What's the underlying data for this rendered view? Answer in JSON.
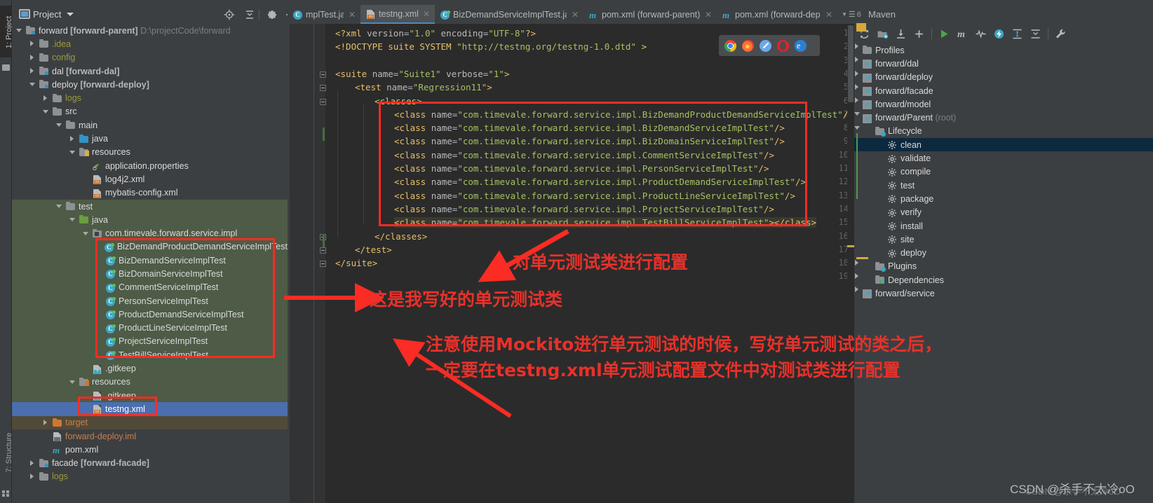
{
  "window": {
    "left_tool_labels": [
      "1: Project",
      "7: Structure"
    ]
  },
  "project_panel": {
    "title": "Project",
    "icons": [
      "locate-icon",
      "collapse-all-icon",
      "gear-icon",
      "minimize-icon"
    ],
    "tree": [
      {
        "indent": 0,
        "twisty": "open",
        "icon": "module-folder-icon",
        "label": "forward ",
        "bold": "[forward-parent]",
        "suffix": "  D:\\projectCode\\forward",
        "style": "white"
      },
      {
        "indent": 1,
        "twisty": "closed",
        "icon": "folder-icon",
        "label": ".idea",
        "style": "folder-yellow"
      },
      {
        "indent": 1,
        "twisty": "closed",
        "icon": "folder-icon",
        "label": "config",
        "style": "folder-yellow"
      },
      {
        "indent": 1,
        "twisty": "closed",
        "icon": "module-folder-icon",
        "label": "dal ",
        "bold": "[forward-dal]",
        "style": "white"
      },
      {
        "indent": 1,
        "twisty": "open",
        "icon": "module-folder-icon",
        "label": "deploy ",
        "bold": "[forward-deploy]",
        "style": "white"
      },
      {
        "indent": 2,
        "twisty": "closed",
        "icon": "folder-icon",
        "label": "logs",
        "style": "folder-yellow"
      },
      {
        "indent": 2,
        "twisty": "open",
        "icon": "folder-icon",
        "label": "src",
        "style": "white"
      },
      {
        "indent": 3,
        "twisty": "open",
        "icon": "folder-icon",
        "label": "main",
        "style": "white"
      },
      {
        "indent": 4,
        "twisty": "closed",
        "icon": "source-folder-blue-icon",
        "label": "java",
        "style": "white"
      },
      {
        "indent": 4,
        "twisty": "open",
        "icon": "resources-folder-icon",
        "label": "resources",
        "style": "white"
      },
      {
        "indent": 5,
        "twisty": "none",
        "icon": "properties-file-icon",
        "label": "application.properties",
        "style": "white"
      },
      {
        "indent": 5,
        "twisty": "none",
        "icon": "xml-file-icon",
        "label": "log4j2.xml",
        "style": "white"
      },
      {
        "indent": 5,
        "twisty": "none",
        "icon": "xml-file-icon",
        "label": "mybatis-config.xml",
        "style": "white"
      },
      {
        "indent": 3,
        "twisty": "open",
        "icon": "folder-icon",
        "label": "test",
        "style": "white",
        "bg": "green"
      },
      {
        "indent": 4,
        "twisty": "open",
        "icon": "test-source-folder-green-icon",
        "label": "java",
        "style": "white",
        "bg": "green"
      },
      {
        "indent": 5,
        "twisty": "open",
        "icon": "package-icon",
        "label": "com.timevale.forward.service.impl",
        "style": "white",
        "bg": "green"
      },
      {
        "indent": 6,
        "twisty": "none",
        "icon": "java-test-class-icon",
        "label": "BizDemandProductDemandServiceImplTest",
        "style": "white",
        "bg": "green"
      },
      {
        "indent": 6,
        "twisty": "none",
        "icon": "java-test-class-icon",
        "label": "BizDemandServiceImplTest",
        "style": "white",
        "bg": "green"
      },
      {
        "indent": 6,
        "twisty": "none",
        "icon": "java-test-class-icon",
        "label": "BizDomainServiceImplTest",
        "style": "white",
        "bg": "green"
      },
      {
        "indent": 6,
        "twisty": "none",
        "icon": "java-test-class-icon",
        "label": "CommentServiceImplTest",
        "style": "white",
        "bg": "green"
      },
      {
        "indent": 6,
        "twisty": "none",
        "icon": "java-test-class-icon",
        "label": "PersonServiceImplTest",
        "style": "white",
        "bg": "green"
      },
      {
        "indent": 6,
        "twisty": "none",
        "icon": "java-test-class-icon",
        "label": "ProductDemandServiceImplTest",
        "style": "white",
        "bg": "green"
      },
      {
        "indent": 6,
        "twisty": "none",
        "icon": "java-test-class-icon",
        "label": "ProductLineServiceImplTest",
        "style": "white",
        "bg": "green"
      },
      {
        "indent": 6,
        "twisty": "none",
        "icon": "java-test-class-icon",
        "label": "ProjectServiceImplTest",
        "style": "white",
        "bg": "green"
      },
      {
        "indent": 6,
        "twisty": "none",
        "icon": "java-test-class-icon",
        "label": "TestBillServiceImplTest",
        "style": "white",
        "bg": "green"
      },
      {
        "indent": 5,
        "twisty": "none",
        "icon": "gitkeep-file-icon",
        "label": ".gitkeep",
        "style": "white",
        "bg": "green"
      },
      {
        "indent": 4,
        "twisty": "open",
        "icon": "test-resources-folder-icon",
        "label": "resources",
        "style": "white",
        "bg": "green"
      },
      {
        "indent": 5,
        "twisty": "none",
        "icon": "gitkeep-file-icon",
        "label": ".gitkeep",
        "style": "white",
        "bg": "green"
      },
      {
        "indent": 5,
        "twisty": "none",
        "icon": "xml-file-icon",
        "label": "testng.xml",
        "style": "white",
        "bg": "selected"
      },
      {
        "indent": 2,
        "twisty": "closed",
        "icon": "target-folder-orange-icon",
        "label": "target",
        "style": "orange",
        "bg": "brown"
      },
      {
        "indent": 2,
        "twisty": "none",
        "icon": "iml-file-icon",
        "label": "forward-deploy.iml",
        "style": "orange"
      },
      {
        "indent": 2,
        "twisty": "none",
        "icon": "maven-pom-icon",
        "label": "pom.xml",
        "style": "white"
      },
      {
        "indent": 1,
        "twisty": "closed",
        "icon": "module-folder-icon",
        "label": "facade ",
        "bold": "[forward-facade]",
        "style": "white"
      },
      {
        "indent": 1,
        "twisty": "closed",
        "icon": "folder-icon",
        "label": "logs",
        "style": "folder-yellow"
      }
    ]
  },
  "editor_tabs": {
    "tabs": [
      {
        "label": "mplTest.java",
        "icon": "java-class-icon",
        "active": false,
        "truncated": true
      },
      {
        "label": "testng.xml",
        "icon": "xml-file-icon",
        "active": true
      },
      {
        "label": "BizDemandServiceImplTest.java",
        "icon": "java-test-class-icon",
        "active": false
      },
      {
        "label": "pom.xml (forward-parent)",
        "icon": "maven-pom-icon",
        "active": false
      },
      {
        "label": "pom.xml (forward-deplo",
        "icon": "maven-pom-icon",
        "active": false,
        "truncated": true
      }
    ],
    "overflow_count": "6",
    "maven_tab_title": "Maven"
  },
  "editor": {
    "filename": "testng.xml",
    "line_numbers": [
      "1",
      "2",
      "3",
      "4",
      "5",
      "6",
      "7",
      "8",
      "9",
      "10",
      "11",
      "12",
      "13",
      "14",
      "15",
      "16",
      "17",
      "18",
      "19"
    ],
    "lines": [
      {
        "n": 1,
        "indent": 0,
        "spans": [
          {
            "t": "tag",
            "v": "<?xml "
          },
          {
            "t": "attr",
            "v": "version"
          },
          {
            "t": "plain",
            "v": "="
          },
          {
            "t": "str",
            "v": "\"1.0\""
          },
          {
            "t": "attr",
            "v": " encoding"
          },
          {
            "t": "plain",
            "v": "="
          },
          {
            "t": "str",
            "v": "\"UTF-8\""
          },
          {
            "t": "tag",
            "v": "?>"
          }
        ]
      },
      {
        "n": 2,
        "indent": 0,
        "spans": [
          {
            "t": "tag",
            "v": "<!DOCTYPE suite SYSTEM "
          },
          {
            "t": "str",
            "v": "\"http://testng.org/testng-1.0.dtd\""
          },
          {
            "t": "tag",
            "v": " >"
          }
        ]
      },
      {
        "n": 3,
        "indent": 0,
        "spans": []
      },
      {
        "n": 4,
        "indent": 0,
        "spans": [
          {
            "t": "tag",
            "v": "<suite "
          },
          {
            "t": "attr",
            "v": "name"
          },
          {
            "t": "plain",
            "v": "="
          },
          {
            "t": "str",
            "v": "\"Suite1\""
          },
          {
            "t": "attr",
            "v": " verbose"
          },
          {
            "t": "plain",
            "v": "="
          },
          {
            "t": "str",
            "v": "\"1\""
          },
          {
            "t": "tag",
            "v": ">"
          }
        ]
      },
      {
        "n": 5,
        "indent": 1,
        "spans": [
          {
            "t": "tag",
            "v": "<test "
          },
          {
            "t": "attr",
            "v": "name"
          },
          {
            "t": "plain",
            "v": "="
          },
          {
            "t": "str",
            "v": "\"Regression11\""
          },
          {
            "t": "tag",
            "v": ">"
          }
        ]
      },
      {
        "n": 6,
        "indent": 2,
        "spans": [
          {
            "t": "tag",
            "v": "<classes>"
          }
        ]
      },
      {
        "n": 7,
        "indent": 3,
        "spans": [
          {
            "t": "tag",
            "v": "<class "
          },
          {
            "t": "attr",
            "v": "name"
          },
          {
            "t": "plain",
            "v": "="
          },
          {
            "t": "str",
            "v": "\"com.timevale.forward.service.impl.BizDemandProductDemandServiceImplTest\""
          },
          {
            "t": "tag",
            "v": "/>"
          }
        ]
      },
      {
        "n": 8,
        "indent": 3,
        "spans": [
          {
            "t": "tag",
            "v": "<class "
          },
          {
            "t": "attr",
            "v": "name"
          },
          {
            "t": "plain",
            "v": "="
          },
          {
            "t": "str",
            "v": "\"com.timevale.forward.service.impl.BizDemandServiceImplTest\""
          },
          {
            "t": "tag",
            "v": "/>"
          }
        ]
      },
      {
        "n": 9,
        "indent": 3,
        "spans": [
          {
            "t": "tag",
            "v": "<class "
          },
          {
            "t": "attr",
            "v": "name"
          },
          {
            "t": "plain",
            "v": "="
          },
          {
            "t": "str",
            "v": "\"com.timevale.forward.service.impl.BizDomainServiceImplTest\""
          },
          {
            "t": "tag",
            "v": "/>"
          }
        ]
      },
      {
        "n": 10,
        "indent": 3,
        "spans": [
          {
            "t": "tag",
            "v": "<class "
          },
          {
            "t": "attr",
            "v": "name"
          },
          {
            "t": "plain",
            "v": "="
          },
          {
            "t": "str",
            "v": "\"com.timevale.forward.service.impl.CommentServiceImplTest\""
          },
          {
            "t": "tag",
            "v": "/>"
          }
        ]
      },
      {
        "n": 11,
        "indent": 3,
        "spans": [
          {
            "t": "tag",
            "v": "<class "
          },
          {
            "t": "attr",
            "v": "name"
          },
          {
            "t": "plain",
            "v": "="
          },
          {
            "t": "str",
            "v": "\"com.timevale.forward.service.impl.PersonServiceImplTest\""
          },
          {
            "t": "tag",
            "v": "/>"
          }
        ]
      },
      {
        "n": 12,
        "indent": 3,
        "spans": [
          {
            "t": "tag",
            "v": "<class "
          },
          {
            "t": "attr",
            "v": "name"
          },
          {
            "t": "plain",
            "v": "="
          },
          {
            "t": "str",
            "v": "\"com.timevale.forward.service.impl.ProductDemandServiceImplTest\""
          },
          {
            "t": "tag",
            "v": "/>"
          }
        ]
      },
      {
        "n": 13,
        "indent": 3,
        "spans": [
          {
            "t": "tag",
            "v": "<class "
          },
          {
            "t": "attr",
            "v": "name"
          },
          {
            "t": "plain",
            "v": "="
          },
          {
            "t": "str",
            "v": "\"com.timevale.forward.service.impl.ProductLineServiceImplTest\""
          },
          {
            "t": "tag",
            "v": "/>"
          }
        ]
      },
      {
        "n": 14,
        "indent": 3,
        "spans": [
          {
            "t": "tag",
            "v": "<class "
          },
          {
            "t": "attr",
            "v": "name"
          },
          {
            "t": "plain",
            "v": "="
          },
          {
            "t": "str",
            "v": "\"com.timevale.forward.service.impl.ProjectServiceImplTest\""
          },
          {
            "t": "tag",
            "v": "/>"
          }
        ]
      },
      {
        "n": 15,
        "indent": 3,
        "spans": [
          {
            "t": "tag",
            "v": "<class "
          },
          {
            "t": "attr",
            "v": "name"
          },
          {
            "t": "plain",
            "v": "="
          },
          {
            "t": "str",
            "v": "\"com.timevale.forward.service.impl.TestBillServiceImplTest\""
          },
          {
            "t": "tag",
            "v": "></class>"
          }
        ],
        "highlight": true
      },
      {
        "n": 16,
        "indent": 2,
        "spans": [
          {
            "t": "tag",
            "v": "</classes>"
          }
        ]
      },
      {
        "n": 17,
        "indent": 1,
        "spans": [
          {
            "t": "tag",
            "v": "</test>"
          }
        ]
      },
      {
        "n": 18,
        "indent": 0,
        "spans": [
          {
            "t": "tag",
            "v": "</suite>"
          }
        ]
      },
      {
        "n": 19,
        "indent": 0,
        "spans": []
      }
    ],
    "browser_icons": [
      "chrome-icon",
      "firefox-icon",
      "safari-icon",
      "opera-icon",
      "edge-icon"
    ]
  },
  "maven_panel": {
    "title": "Maven",
    "toolbar_icons": [
      "reimport-icon",
      "generate-sources-icon",
      "download-sources-icon",
      "add-maven-project-icon",
      "run-icon",
      "execute-maven-goal-icon",
      "toggle-skip-tests-icon",
      "toggle-offline-icon",
      "expand-all-icon",
      "collapse-all-icon",
      "settings-wrench-icon"
    ],
    "tree": [
      {
        "indent": 0,
        "twisty": "closed",
        "icon": "profiles-folder-icon",
        "label": "Profiles"
      },
      {
        "indent": 0,
        "twisty": "closed",
        "icon": "maven-module-icon",
        "label": "forward/dal"
      },
      {
        "indent": 0,
        "twisty": "closed",
        "icon": "maven-module-icon",
        "label": "forward/deploy"
      },
      {
        "indent": 0,
        "twisty": "closed",
        "icon": "maven-module-icon",
        "label": "forward/facade"
      },
      {
        "indent": 0,
        "twisty": "closed",
        "icon": "maven-module-icon",
        "label": "forward/model"
      },
      {
        "indent": 0,
        "twisty": "open",
        "icon": "maven-module-icon",
        "label": "forward/Parent",
        "suffix": " (root)"
      },
      {
        "indent": 1,
        "twisty": "open",
        "icon": "lifecycle-folder-icon",
        "label": "Lifecycle"
      },
      {
        "indent": 2,
        "twisty": "none",
        "icon": "gear-icon",
        "label": "clean",
        "selected": true
      },
      {
        "indent": 2,
        "twisty": "none",
        "icon": "gear-icon",
        "label": "validate"
      },
      {
        "indent": 2,
        "twisty": "none",
        "icon": "gear-icon",
        "label": "compile"
      },
      {
        "indent": 2,
        "twisty": "none",
        "icon": "gear-icon",
        "label": "test"
      },
      {
        "indent": 2,
        "twisty": "none",
        "icon": "gear-icon",
        "label": "package"
      },
      {
        "indent": 2,
        "twisty": "none",
        "icon": "gear-icon",
        "label": "verify"
      },
      {
        "indent": 2,
        "twisty": "none",
        "icon": "gear-icon",
        "label": "install"
      },
      {
        "indent": 2,
        "twisty": "none",
        "icon": "gear-icon",
        "label": "site"
      },
      {
        "indent": 2,
        "twisty": "none",
        "icon": "gear-icon",
        "label": "deploy"
      },
      {
        "indent": 1,
        "twisty": "closed",
        "icon": "plugins-folder-icon",
        "label": "Plugins"
      },
      {
        "indent": 1,
        "twisty": "closed",
        "icon": "dependencies-folder-icon",
        "label": "Dependencies"
      },
      {
        "indent": 0,
        "twisty": "closed",
        "icon": "maven-module-icon",
        "label": "forward/service"
      }
    ]
  },
  "annotations": {
    "accent_color": "#fa2c24",
    "texts": [
      {
        "id": "ann-config-classes",
        "text": "对单元测试类进行配置"
      },
      {
        "id": "ann-my-test-classes",
        "text": "这是我写好的单元测试类"
      },
      {
        "id": "ann-mockito-line1",
        "text": "注意使用Mockito进行单元测试的时候，写好单元测试的类之后，"
      },
      {
        "id": "ann-mockito-line2",
        "text": "一定要在testng.xml单元测试配置文件中对测试类进行配置"
      }
    ]
  },
  "watermark": {
    "main": "CSDN @杀手不太冷oO",
    "faint": "CSDN @杀手不太冷oO"
  }
}
